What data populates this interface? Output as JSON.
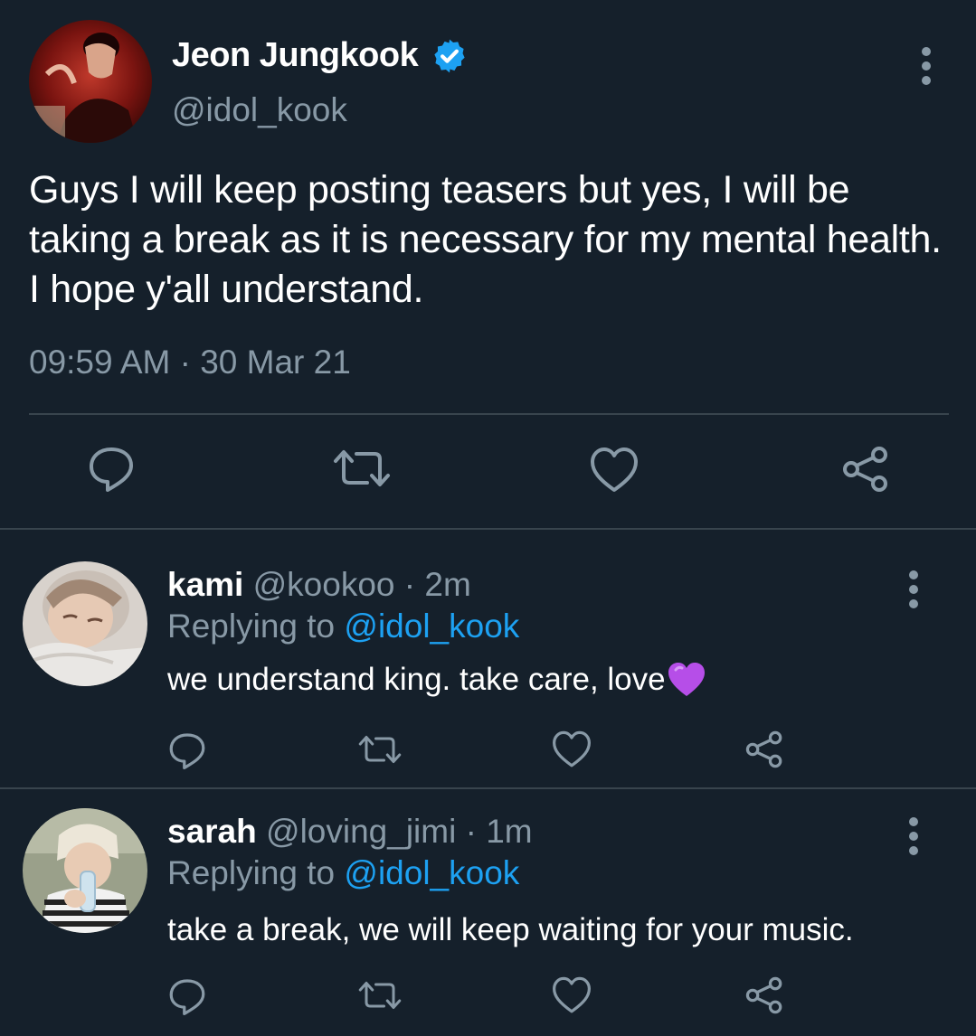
{
  "main_tweet": {
    "name": "Jeon Jungkook",
    "handle": "@idol_kook",
    "text": "Guys I will keep posting teasers but yes, I will be taking a break as it is necessary for my mental health. I hope y'all understand.",
    "timestamp": "09:59 AM · 30 Mar 21",
    "verified": true,
    "actions": [
      "reply-icon",
      "retweet-icon",
      "like-icon",
      "share-icon"
    ]
  },
  "replies": [
    {
      "name": "kami",
      "handle": "@kookoo",
      "separator": "·",
      "ago": "2m",
      "replying_prefix": "Replying to ",
      "replying_to": "@idol_kook",
      "text": "we understand king. take care, love",
      "emoji": "purple-heart-icon"
    },
    {
      "name": "sarah",
      "handle": "@loving_jimi",
      "separator": "·",
      "ago": "1m",
      "replying_prefix": "Replying to ",
      "replying_to": "@idol_kook",
      "text": "take a break, we will keep waiting for your music."
    }
  ],
  "colors": {
    "background": "#15202b",
    "divider": "#38444d",
    "secondary_text": "#8899a6",
    "accent": "#1da1f2",
    "verified": "#1da1f2"
  }
}
